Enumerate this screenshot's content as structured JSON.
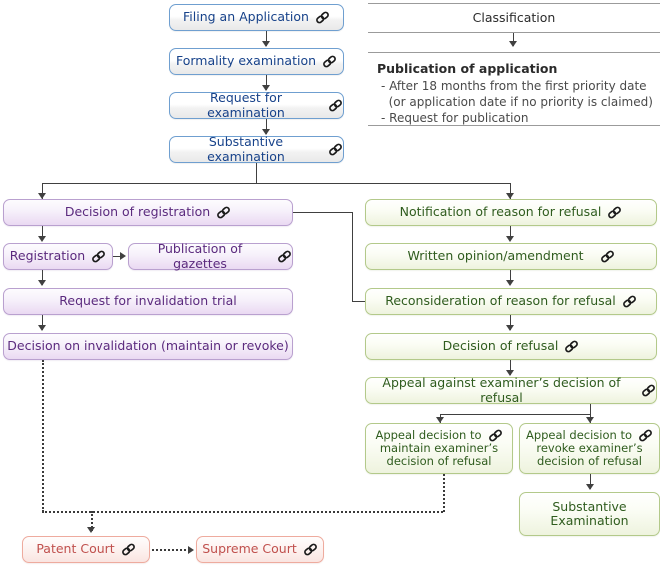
{
  "diagram": {
    "title": "Patent application examination flowchart",
    "icon_name": "link-icon",
    "colors": {
      "blue_border": "#6f9fd0",
      "blue_text": "#17428a",
      "purple_border": "#b9a0cf",
      "purple_text": "#5b2a7e",
      "green_border": "#b3c98a",
      "green_text": "#2f5c1e",
      "red_border": "#eeab9e",
      "red_text": "#c0504d",
      "connector": "#404040",
      "rule": "#9b9b9b"
    }
  },
  "main_flow": [
    {
      "id": "filing",
      "label": "Filing an Application",
      "icon": true
    },
    {
      "id": "formality",
      "label": "Formality examination",
      "icon": true
    },
    {
      "id": "request",
      "label": "Request for examination",
      "icon": true
    },
    {
      "id": "substantive",
      "label": "Substantive examination",
      "icon": true
    }
  ],
  "classification_panel": {
    "title": "Classification",
    "publication_heading": "Publication of application",
    "publication_lines": "- After 18 months from the first priority date\n  (or application date if no priority is claimed)\n- Request for publication"
  },
  "registration_branch": [
    {
      "id": "decision-registration",
      "label": "Decision of registration",
      "icon": true
    },
    {
      "id": "registration",
      "label": "Registration",
      "icon": true
    },
    {
      "id": "publication-gazettes",
      "label": "Publication of gazettes",
      "icon": true
    },
    {
      "id": "request-invalidation",
      "label": "Request for invalidation trial",
      "icon": false
    },
    {
      "id": "decision-invalidation",
      "label": "Decision on invalidation (maintain or revoke)",
      "icon": false
    }
  ],
  "refusal_branch": [
    {
      "id": "notification-refusal",
      "label": "Notification of reason for refusal",
      "icon": true
    },
    {
      "id": "written-opinion",
      "label": "Written opinion/amendment",
      "icon": true
    },
    {
      "id": "reconsideration",
      "label": "Reconsideration of reason for refusal",
      "icon": true
    },
    {
      "id": "decision-refusal",
      "label": "Decision of refusal",
      "icon": true
    },
    {
      "id": "appeal-against",
      "label": "Appeal against examiner’s decision of refusal",
      "icon": true
    }
  ],
  "appeal_outcomes": [
    {
      "id": "appeal-maintain",
      "line1": "Appeal decision to",
      "line2": "maintain examiner’s",
      "line3": "decision of refusal",
      "icon": true
    },
    {
      "id": "appeal-revoke",
      "line1": "Appeal decision to",
      "line2": "revoke examiner’s",
      "line3": "decision of refusal",
      "icon": true
    }
  ],
  "substantive_examination_2": {
    "line1": "Substantive",
    "line2": "Examination",
    "icon": false
  },
  "courts": [
    {
      "id": "patent-court",
      "label": "Patent Court",
      "icon": true
    },
    {
      "id": "supreme-court",
      "label": "Supreme Court",
      "icon": true
    }
  ]
}
